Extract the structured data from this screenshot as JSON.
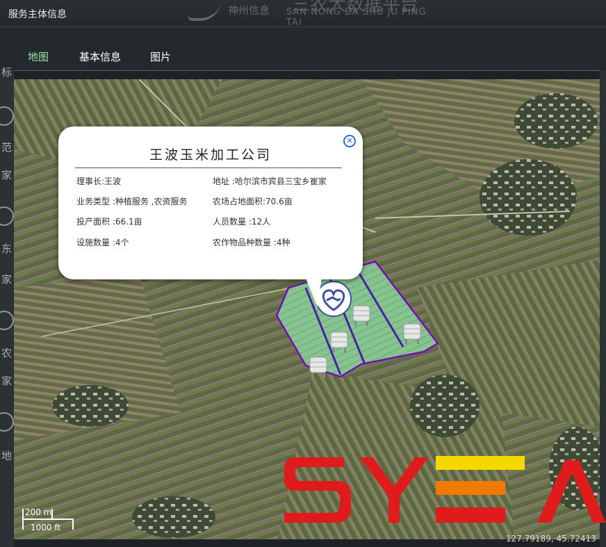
{
  "window": {
    "title": "服务主体信息",
    "brand_cn": "神州信息",
    "brand_en": "SAN NONG DA SHU JU PING TAI",
    "brand_big": "三农大数据平台"
  },
  "tabs": [
    {
      "label": "地图",
      "active": true
    },
    {
      "label": "基本信息",
      "active": false
    },
    {
      "label": "图片",
      "active": false
    }
  ],
  "left_strip_chars": [
    "标",
    "范",
    "家",
    "东",
    "家",
    "农",
    "家",
    "地"
  ],
  "popup": {
    "title": "王波玉米加工公司",
    "close_icon": "close-circle-icon",
    "fields": [
      {
        "label": "理事长:",
        "value": "王波"
      },
      {
        "label": "地址 :",
        "value": "哈尔滨市宾县三宝乡崔家"
      },
      {
        "label": "业务类型 :",
        "value": "种植服务 ,农资服务"
      },
      {
        "label": "农场占地面积:",
        "value": "70.6亩"
      },
      {
        "label": "投产面积 :",
        "value": "66.1亩"
      },
      {
        "label": "人员数量 :",
        "value": "12人"
      },
      {
        "label": "设施数量 :",
        "value": "4个"
      },
      {
        "label": "农作物品种数量 :",
        "value": "4种"
      }
    ]
  },
  "map": {
    "marker_icon": "handshake-heart-icon",
    "facility_icon": "storage-tank-icon",
    "facility_count": 4
  },
  "scale": {
    "top": "200 m",
    "bottom": "1000 ft"
  },
  "coords": "127.79189, 45.72413",
  "watermark": "SYEA",
  "colors": {
    "accent_tab": "#9fe0a8",
    "field_outline": "#c26bc2",
    "plot_border": "#4a1fa8",
    "plot_fill": "#7fc08a",
    "popup_close": "#2f6bd8",
    "watermark_red": "#e01b1b",
    "watermark_yellow": "#f5d800",
    "watermark_orange": "#f07a00"
  }
}
